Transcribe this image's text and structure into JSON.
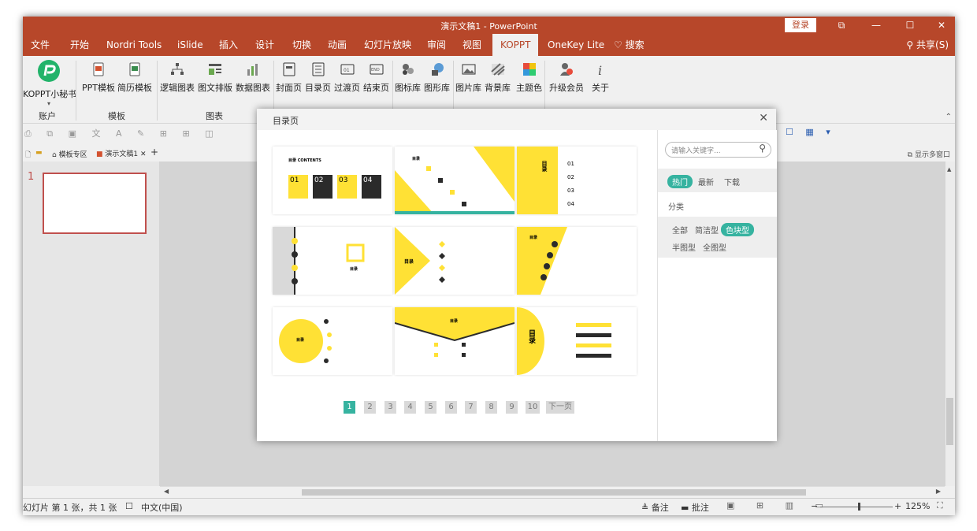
{
  "window": {
    "title": "演示文稿1 - PowerPoint",
    "login_label": "登录",
    "restore_icon": "window-restore-icon",
    "minimize_icon": "minimize-icon",
    "maximize_icon": "maximize-icon",
    "close_icon": "close-icon"
  },
  "ribbon_tabs": [
    "文件",
    "开始",
    "Nordri Tools",
    "iSlide",
    "插入",
    "设计",
    "切换",
    "动画",
    "幻灯片放映",
    "审阅",
    "视图",
    "KOPPT",
    "OneKey Lite"
  ],
  "active_tab": "KOPPT",
  "search_tab": "搜索",
  "share_label": "共享(S)",
  "ribbon_buttons": [
    {
      "label": "KOPPT小秘书",
      "icon": "koppt-logo-icon"
    },
    {
      "label": "PPT模板",
      "icon": "ppt-template-icon"
    },
    {
      "label": "简历模板",
      "icon": "resume-template-icon"
    },
    {
      "label": "逻辑图表",
      "icon": "logic-chart-icon"
    },
    {
      "label": "图文排版",
      "icon": "layout-icon"
    },
    {
      "label": "数据图表",
      "icon": "data-chart-icon"
    },
    {
      "label": "封面页",
      "icon": "cover-page-icon"
    },
    {
      "label": "目录页",
      "icon": "contents-page-icon"
    },
    {
      "label": "过渡页",
      "icon": "transition-page-icon"
    },
    {
      "label": "结束页",
      "icon": "end-page-icon"
    },
    {
      "label": "图标库",
      "icon": "icon-library-icon"
    },
    {
      "label": "图形库",
      "icon": "shape-library-icon"
    },
    {
      "label": "图片库",
      "icon": "picture-library-icon"
    },
    {
      "label": "背景库",
      "icon": "background-library-icon"
    },
    {
      "label": "主题色",
      "icon": "theme-color-icon"
    },
    {
      "label": "升级会员",
      "icon": "upgrade-member-icon"
    },
    {
      "label": "关于",
      "icon": "info-icon"
    }
  ],
  "ribbon_groups": [
    "账户",
    "模板",
    "图表"
  ],
  "doc_tabs": {
    "home": "模板专区",
    "file": "演示文稿1",
    "show_multi": "显示多窗口"
  },
  "slide_number": "1",
  "dialog": {
    "title": "目录页",
    "search_placeholder": "请输入关键字...",
    "sort_tabs": [
      "热门",
      "最新",
      "下载"
    ],
    "active_sort": "热门",
    "category_label": "分类",
    "categories": [
      "全部",
      "简洁型",
      "色块型",
      "半图型",
      "全图型"
    ],
    "active_category": "色块型",
    "pages": [
      "1",
      "2",
      "3",
      "4",
      "5",
      "6",
      "7",
      "8",
      "9",
      "10"
    ],
    "active_page": "1",
    "next_label": "下一页",
    "templates": [
      {
        "title": "目录 CONTENTS",
        "nums": [
          "01",
          "02",
          "03",
          "04"
        ]
      },
      {
        "title": "目录"
      },
      {
        "title": "目录",
        "nums": [
          "01",
          "02",
          "03",
          "04"
        ]
      },
      {
        "title": "目录"
      },
      {
        "title": "目录"
      },
      {
        "title": "目录"
      },
      {
        "title": "目录"
      },
      {
        "title": "目录"
      },
      {
        "title": "目录"
      }
    ]
  },
  "status": {
    "slide_info": "幻灯片 第 1 张，共 1 张",
    "language": "中文(中国)",
    "notes": "备注",
    "comments": "批注",
    "zoom": "125%"
  },
  "colors": {
    "brand": "#b7472a",
    "accent_yellow": "#ffe135",
    "dark": "#2b2b2b",
    "teal": "#36b3a0"
  }
}
